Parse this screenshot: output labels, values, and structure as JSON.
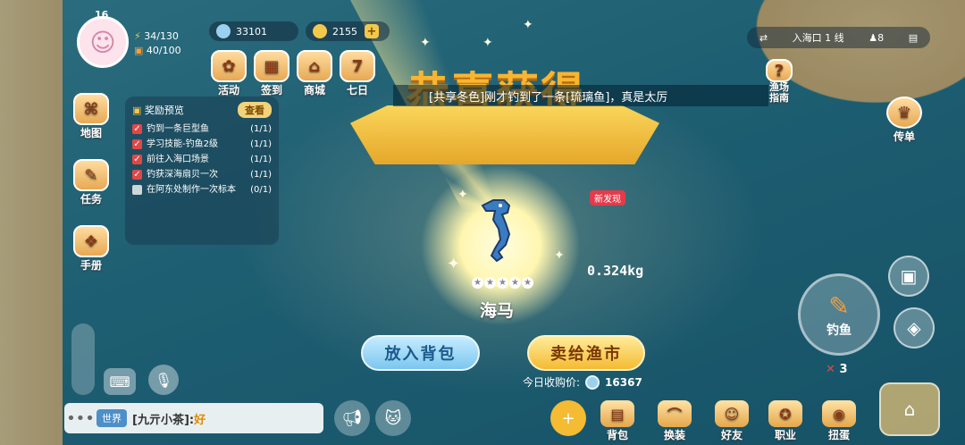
{
  "hud": {
    "level": "16",
    "energy": "34/130",
    "bag": "40/100",
    "shells": "33101",
    "coins": "2155"
  },
  "top_icons": [
    {
      "label": "活动",
      "icon": "gift-icon"
    },
    {
      "label": "签到",
      "icon": "calendar-icon"
    },
    {
      "label": "商城",
      "icon": "shop-icon"
    },
    {
      "label": "七日",
      "icon": "seven-day-icon"
    }
  ],
  "left_icons": [
    {
      "label": "地图",
      "icon": "map-icon"
    },
    {
      "label": "任务",
      "icon": "task-icon"
    },
    {
      "label": "手册",
      "icon": "handbook-icon"
    }
  ],
  "quest": {
    "title": "奖励预览",
    "view_label": "查看",
    "items": [
      {
        "label": "钓到一条巨型鱼",
        "progress": "(1/1)",
        "done": true
      },
      {
        "label": "学习技能-钓鱼2级",
        "progress": "(1/1)",
        "done": true
      },
      {
        "label": "前往入海口场景",
        "progress": "(1/1)",
        "done": true
      },
      {
        "label": "钓获深海扇贝一次",
        "progress": "(1/1)",
        "done": true
      },
      {
        "label": "在阿东处制作一次标本",
        "progress": "(0/1)",
        "done": false
      }
    ]
  },
  "announce": "[共享冬色]刚才钓到了一条[琉璃鱼]，真是太厉",
  "banner_title": "恭喜获得",
  "catch": {
    "name": "海马",
    "weight": "0.324kg",
    "new_tag": "新发现",
    "stars": [
      "★",
      "★",
      "★",
      "★",
      "★"
    ]
  },
  "buttons": {
    "bag": "放入背包",
    "sell": "卖给渔市"
  },
  "price": {
    "label": "今日收购价:",
    "value": "16367"
  },
  "right": {
    "location": "入海口 1 线",
    "players": "8",
    "guide": "渔场指南",
    "legend": "传单",
    "fish_label": "钓鱼",
    "bait": "3"
  },
  "chat": {
    "channel": "世界",
    "user": "[九亓小茶]:",
    "message": "好"
  },
  "dock": [
    "背包",
    "换装",
    "好友",
    "职业",
    "扭蛋"
  ],
  "colors": {
    "accent": "#f4bb33",
    "sea": "#2b7c90",
    "new": "#e33b4b"
  }
}
